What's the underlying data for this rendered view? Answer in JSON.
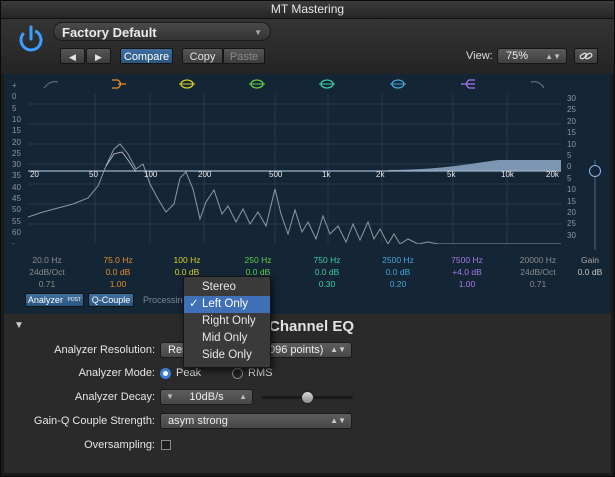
{
  "window": {
    "title": "MT Mastering"
  },
  "header": {
    "preset": "Factory Default",
    "compare": "Compare",
    "copy": "Copy",
    "paste": "Paste",
    "view_label": "View:",
    "view_value": "75%"
  },
  "eq": {
    "freq_ticks": [
      "20",
      "50",
      "100",
      "200",
      "500",
      "1k",
      "2k",
      "5k",
      "10k",
      "20k"
    ],
    "left_scale": [
      "+",
      "0",
      "5",
      "10",
      "15",
      "20",
      "25",
      "30",
      "35",
      "40",
      "45",
      "50",
      "55",
      "60",
      "-"
    ],
    "right_scale": [
      "30",
      "25",
      "20",
      "15",
      "10",
      "5",
      "0",
      "5",
      "10",
      "15",
      "20",
      "25",
      "30"
    ],
    "bands": [
      {
        "freq": "20.0 Hz",
        "gain": "24dB/Oct",
        "q": "0.71",
        "color": "#7d7d7d"
      },
      {
        "freq": "75.0 Hz",
        "gain": "0.0 dB",
        "q": "1.00",
        "color": "#e3902b"
      },
      {
        "freq": "100 Hz",
        "gain": "0.0 dB",
        "q": "",
        "color": "#d8cf2a"
      },
      {
        "freq": "250 Hz",
        "gain": "0.0 dB",
        "q": "",
        "color": "#5fcf47"
      },
      {
        "freq": "750 Hz",
        "gain": "0.0 dB",
        "q": "0.30",
        "color": "#3fcaa0"
      },
      {
        "freq": "2500 Hz",
        "gain": "0.0 dB",
        "q": "0.20",
        "color": "#42a7d8"
      },
      {
        "freq": "7500 Hz",
        "gain": "+4.0 dB",
        "q": "1.00",
        "color": "#a779e8"
      },
      {
        "freq": "20000 Hz",
        "gain": "24dB/Oct",
        "q": "0.71",
        "color": "#7d7d7d"
      }
    ],
    "gain_label": "Gain",
    "gain_value": "0.0 dB",
    "analyzer_btn": "Analyzer",
    "analyzer_badge": "POST",
    "qcouple_btn": "Q-Couple",
    "processing": "Processing"
  },
  "popup": {
    "items": [
      "Stereo",
      "Left Only",
      "Right Only",
      "Mid Only",
      "Side Only"
    ],
    "selected_check": "✓"
  },
  "lower": {
    "section_title": "Channel EQ",
    "analyzer_resolution_label": "Analyzer Resolution:",
    "analyzer_resolution_value_left": "Res",
    "analyzer_resolution_value_right": "096 points)",
    "analyzer_mode_label": "Analyzer Mode:",
    "mode_peak": "Peak",
    "mode_rms": "RMS",
    "analyzer_decay_label": "Analyzer Decay:",
    "decay_value": "10dB/s",
    "gainq_label": "Gain-Q Couple Strength:",
    "gainq_value": "asym strong",
    "oversampling_label": "Oversampling:"
  },
  "colors": {
    "accent": "#3f70b8",
    "eq_bg": "#142536",
    "curve_fill": "#8ea9c8"
  }
}
